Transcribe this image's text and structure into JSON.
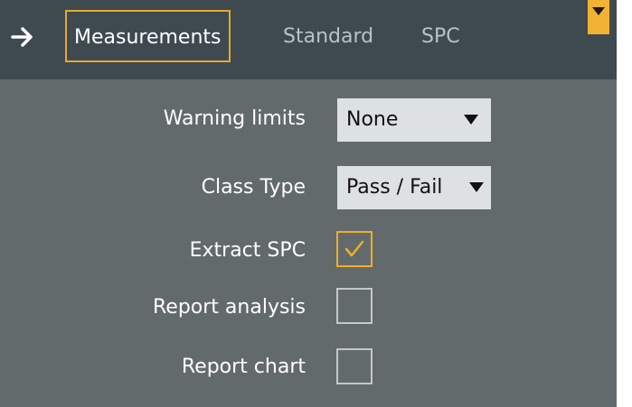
{
  "tabs": [
    {
      "label": "Measurements",
      "active": true
    },
    {
      "label": "Standard",
      "active": false
    },
    {
      "label": "SPC",
      "active": false
    }
  ],
  "icons": {
    "back": "arrow-right-icon",
    "corner_dropdown": "caret-down-icon"
  },
  "colors": {
    "accent": "#f0ad2a",
    "topbar": "#3f4a50",
    "panel": "#636a6b"
  },
  "form": {
    "warning_limits": {
      "label": "Warning limits",
      "value": "None"
    },
    "class_type": {
      "label": "Class Type",
      "value": "Pass / Fail"
    },
    "extract_spc": {
      "label": "Extract SPC",
      "checked": true
    },
    "report_analysis": {
      "label": "Report analysis",
      "checked": false
    },
    "report_chart": {
      "label": "Report chart",
      "checked": false
    }
  }
}
